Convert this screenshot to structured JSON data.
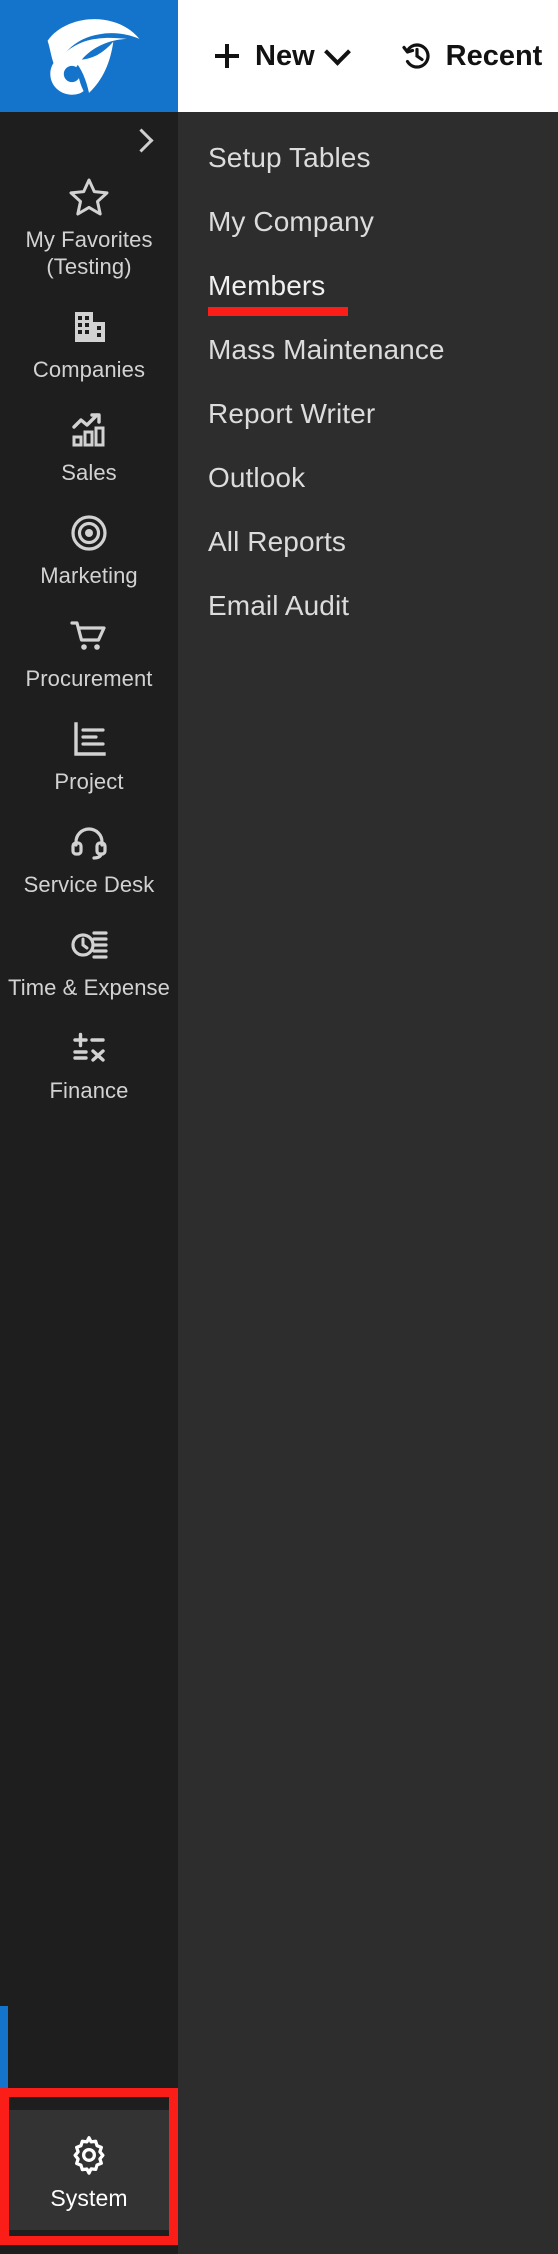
{
  "topbar": {
    "logo_name": "company-logo",
    "actions": [
      {
        "icon": "plus-icon",
        "label": "New",
        "has_dropdown": true
      },
      {
        "icon": "history-clock-icon",
        "label": "Recent",
        "has_dropdown": false
      }
    ]
  },
  "sidebar": {
    "collapse_icon": "chevron-right-icon",
    "items": [
      {
        "icon": "star-icon",
        "label": "My Favorites (Testing)"
      },
      {
        "icon": "building-icon",
        "label": "Companies"
      },
      {
        "icon": "chart-up-icon",
        "label": "Sales"
      },
      {
        "icon": "target-icon",
        "label": "Marketing"
      },
      {
        "icon": "cart-icon",
        "label": "Procurement"
      },
      {
        "icon": "project-list-icon",
        "label": "Project"
      },
      {
        "icon": "headset-icon",
        "label": "Service Desk"
      },
      {
        "icon": "time-clock-icon",
        "label": "Time & Expense"
      },
      {
        "icon": "calculator-icon",
        "label": "Finance"
      }
    ],
    "bottom_item": {
      "icon": "gear-icon",
      "label": "System",
      "highlighted": true
    }
  },
  "menu": {
    "items": [
      {
        "label": "Setup Tables",
        "active": false
      },
      {
        "label": "My Company",
        "active": false
      },
      {
        "label": "Members",
        "active": true
      },
      {
        "label": "Mass Maintenance",
        "active": false
      },
      {
        "label": "Report Writer",
        "active": false
      },
      {
        "label": "Outlook",
        "active": false
      },
      {
        "label": "All Reports",
        "active": false
      },
      {
        "label": "Email Audit",
        "active": false
      }
    ]
  },
  "colors": {
    "brand_blue": "#1474cc",
    "highlight_red": "#fb1d18",
    "sidebar_bg": "#1e1e1e",
    "panel_bg": "#2d2d2d",
    "topbar_bg": "#ffffff"
  }
}
